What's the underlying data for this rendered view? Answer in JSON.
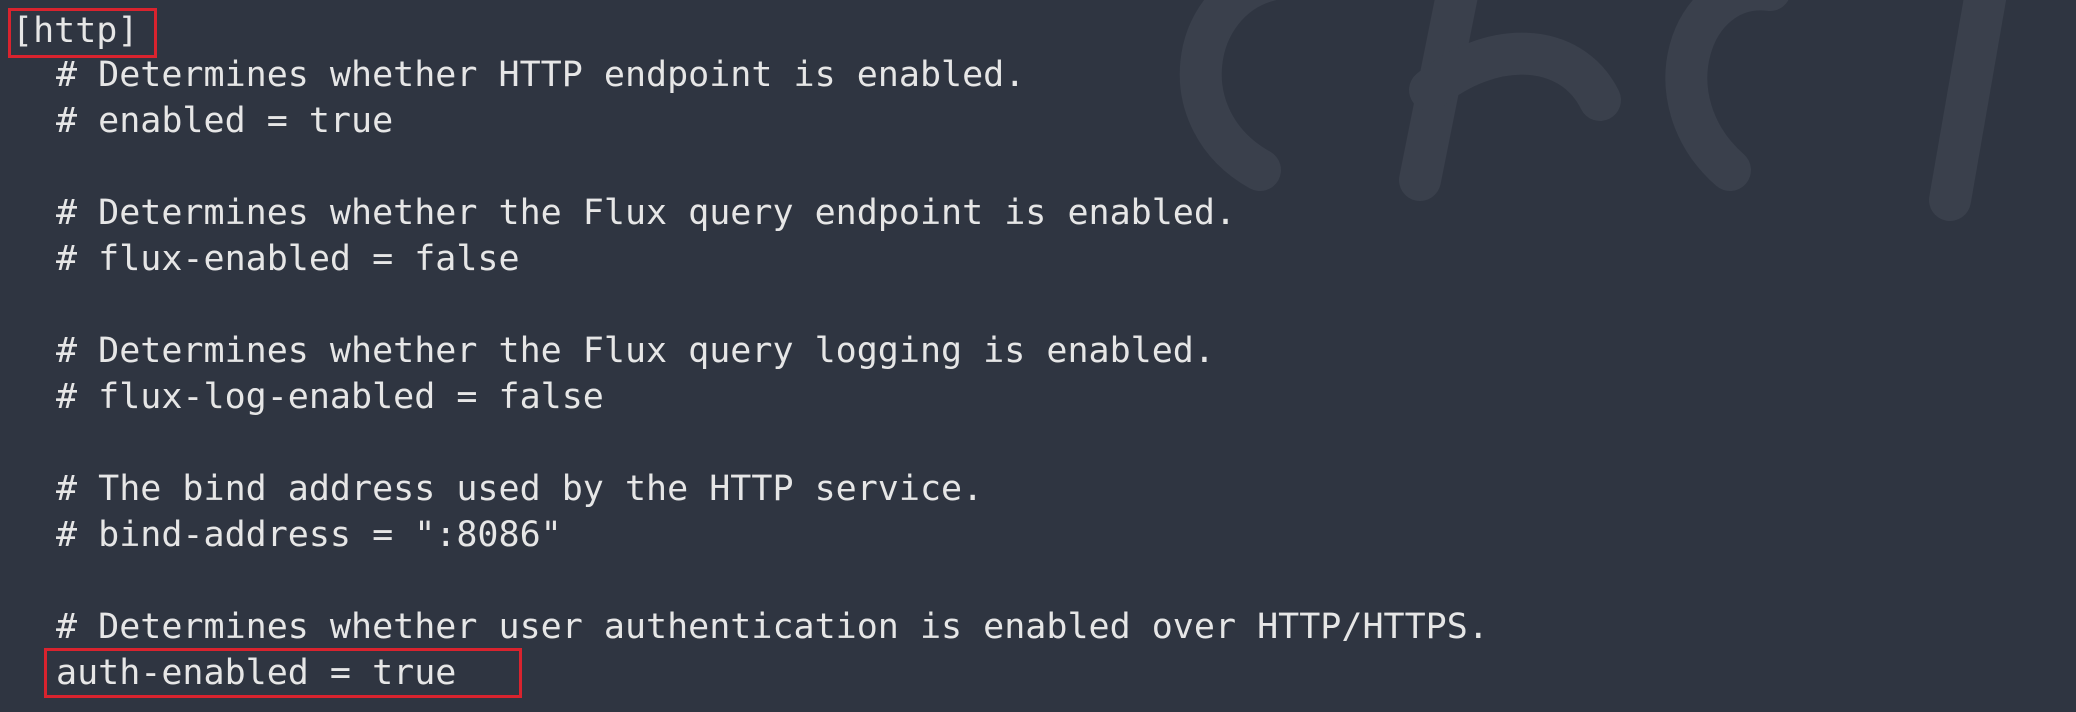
{
  "editor": {
    "lines": [
      "[http]",
      "# Determines whether HTTP endpoint is enabled.",
      "# enabled = true",
      "",
      "# Determines whether the Flux query endpoint is enabled.",
      "# flux-enabled = false",
      "",
      "# Determines whether the Flux query logging is enabled.",
      "# flux-log-enabled = false",
      "",
      "# The bind address used by the HTTP service.",
      "# bind-address = \":8086\"",
      "",
      "# Determines whether user authentication is enabled over HTTP/HTTPS.",
      "auth-enabled = true"
    ]
  },
  "colors": {
    "background": "#2f3541",
    "text": "#e6e6e6",
    "highlight": "#d9232e"
  }
}
